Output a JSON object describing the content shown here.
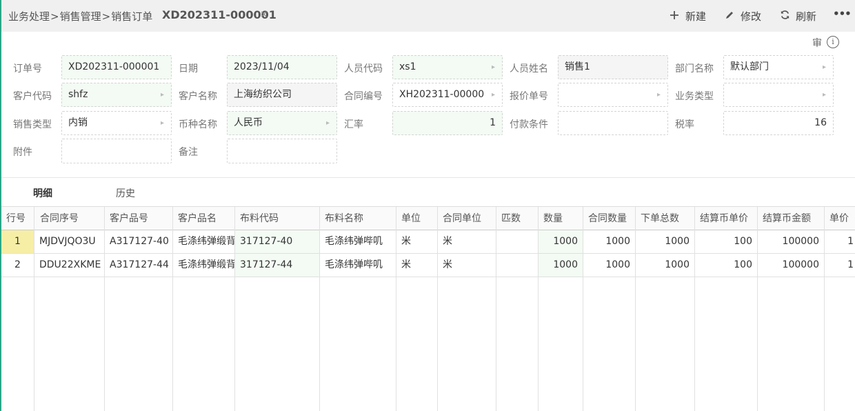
{
  "breadcrumb": {
    "items": [
      "业务处理",
      "销售管理",
      "销售订单"
    ],
    "separator": ">"
  },
  "doc_tab": {
    "title": "XD202311-000001",
    "close": "×"
  },
  "toolbar": {
    "new_label": "新建",
    "edit_label": "修改",
    "refresh_label": "刷新",
    "more": "•••"
  },
  "audit": {
    "label": "审",
    "info": "i"
  },
  "form": {
    "order_no": {
      "label": "订单号",
      "value": "XD202311-000001"
    },
    "date": {
      "label": "日期",
      "value": "2023/11/04"
    },
    "staff_code": {
      "label": "人员代码",
      "value": "xs1"
    },
    "staff_name": {
      "label": "人员姓名",
      "value": "销售1"
    },
    "dept_name": {
      "label": "部门名称",
      "value": "默认部门"
    },
    "customer_code": {
      "label": "客户代码",
      "value": "shfz"
    },
    "customer_name": {
      "label": "客户名称",
      "value": "上海纺织公司"
    },
    "contract_no": {
      "label": "合同编号",
      "value": "XH202311-00000"
    },
    "quote_no": {
      "label": "报价单号",
      "value": ""
    },
    "business_type": {
      "label": "业务类型",
      "value": ""
    },
    "sales_type": {
      "label": "销售类型",
      "value": "内销"
    },
    "currency": {
      "label": "币种名称",
      "value": "人民币"
    },
    "exchange_rate": {
      "label": "汇率",
      "value": "1"
    },
    "payment_terms": {
      "label": "付款条件",
      "value": ""
    },
    "tax_rate": {
      "label": "税率",
      "value": "16"
    },
    "attachment": {
      "label": "附件",
      "value": ""
    },
    "remark": {
      "label": "备注",
      "value": ""
    }
  },
  "tabs": [
    {
      "label": "明细",
      "active": true
    },
    {
      "label": "历史",
      "active": false
    }
  ],
  "grid": {
    "columns": [
      "行号",
      "合同序号",
      "客户品号",
      "客户品名",
      "布料代码",
      "布料名称",
      "单位",
      "合同单位",
      "匹数",
      "数量",
      "合同数量",
      "下单总数",
      "结算币单价",
      "结算币金额",
      "单价"
    ],
    "rows": [
      [
        "1",
        "MJDVJQO3U",
        "A317127-40",
        "毛涤纬弹缎背",
        "317127-40",
        "毛涤纬弹哔叽",
        "米",
        "米",
        "",
        "1000",
        "1000",
        "1000",
        "100",
        "100000",
        "1"
      ],
      [
        "2",
        "DDU22XKME",
        "A317127-44",
        "毛涤纬弹缎背",
        "317127-44",
        "毛涤纬弹哔叽",
        "米",
        "米",
        "",
        "1000",
        "1000",
        "1000",
        "100",
        "100000",
        "1"
      ]
    ]
  },
  "colors": {
    "accent": "#2aa889",
    "selected_row_cell": "#f7eea6",
    "editable_bg": "#f3fbf4"
  }
}
